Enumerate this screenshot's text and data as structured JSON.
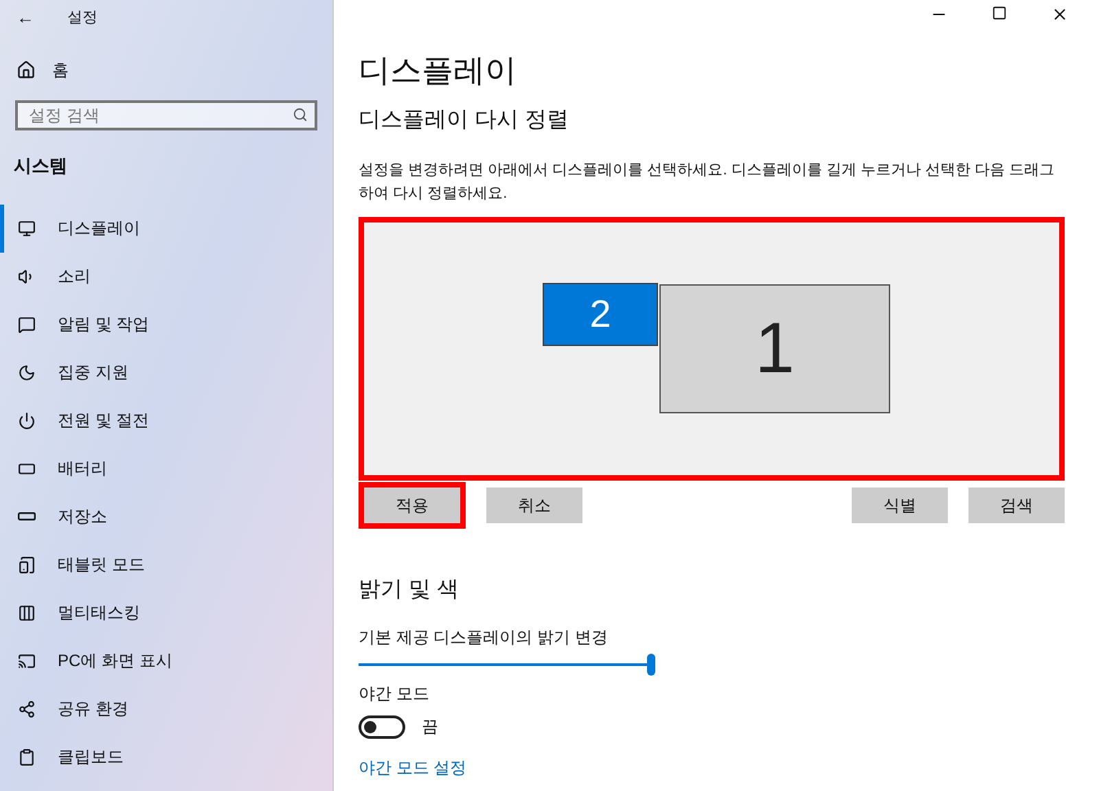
{
  "window": {
    "back": "←",
    "title": "설정"
  },
  "sidebar": {
    "home": "홈",
    "search": {
      "placeholder": "설정 검색"
    },
    "section": "시스템",
    "items": [
      {
        "label": "디스플레이",
        "kind": "monitor",
        "selected": true
      },
      {
        "label": "소리",
        "kind": "sound",
        "selected": false
      },
      {
        "label": "알림 및 작업",
        "kind": "message",
        "selected": false
      },
      {
        "label": "집중 지원",
        "kind": "moon",
        "selected": false
      },
      {
        "label": "전원 및 절전",
        "kind": "power",
        "selected": false
      },
      {
        "label": "배터리",
        "kind": "battery",
        "selected": false
      },
      {
        "label": "저장소",
        "kind": "storage",
        "selected": false
      },
      {
        "label": "태블릿 모드",
        "kind": "tablet",
        "selected": false
      },
      {
        "label": "멀티태스킹",
        "kind": "multitask",
        "selected": false
      },
      {
        "label": "PC에 화면 표시",
        "kind": "project",
        "selected": false
      },
      {
        "label": "공유 환경",
        "kind": "share",
        "selected": false
      },
      {
        "label": "클립보드",
        "kind": "clipboard",
        "selected": false
      }
    ]
  },
  "page_title": "디스플레이",
  "arrange": {
    "heading": "디스플레이 다시 정렬",
    "description": "설정을 변경하려면 아래에서 디스플레이를 선택하세요. 디스플레이를 길게 누르거나 선택한 다음 드래그하여 다시 정렬하세요.",
    "highlighted": true,
    "monitors": [
      {
        "number": "2",
        "selected": true
      },
      {
        "number": "1",
        "selected": false
      }
    ],
    "buttons": [
      {
        "label": "적용",
        "highlighted": true
      },
      {
        "label": "취소",
        "highlighted": false
      }
    ],
    "right_buttons": [
      {
        "label": "식별"
      },
      {
        "label": "검색"
      }
    ]
  },
  "brightness": {
    "heading": "밝기 및 색",
    "slider_label": "기본 제공 디스플레이의 밝기 변경",
    "level": 1.0,
    "night_mode": {
      "label": "야간 모드",
      "on": false,
      "state_text": "끔"
    },
    "link": "야간 모드 설정"
  }
}
